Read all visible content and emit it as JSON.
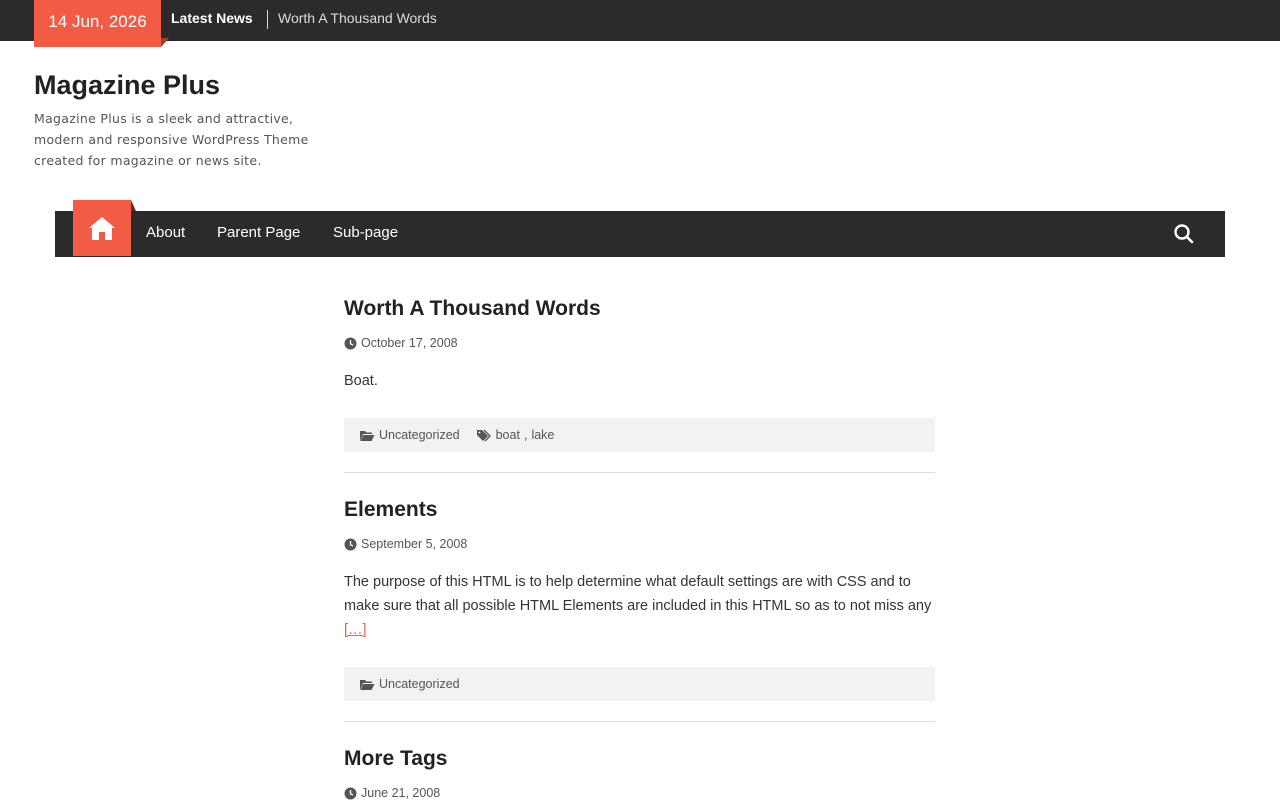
{
  "topbar": {
    "date": "14 Jun, 2026",
    "latest_label": "Latest News",
    "latest_item": "Worth A Thousand Words"
  },
  "site": {
    "title": "Magazine Plus",
    "description": "Magazine Plus is a sleek and attractive, modern and responsive WordPress Theme created for magazine or news site."
  },
  "nav": {
    "items": [
      "About",
      "Parent Page",
      "Sub-page"
    ]
  },
  "colors": {
    "accent": "#f25c45",
    "dark": "#2b2b2b",
    "meta_bg": "#f2f2f2"
  },
  "posts": [
    {
      "title": "Worth A Thousand Words",
      "date": "October 17, 2008",
      "excerpt": "Boat.",
      "category": "Uncategorized",
      "tags": [
        "boat",
        "lake"
      ],
      "tag_sep": ","
    },
    {
      "title": "Elements",
      "date": "September 5, 2008",
      "excerpt": "The purpose of this HTML is to help determine what default settings are with CSS and to make sure that all possible HTML Elements are included in this HTML so as to not miss any",
      "more": "[…]",
      "category": "Uncategorized"
    },
    {
      "title": "More Tags",
      "date": "June 21, 2008"
    }
  ]
}
